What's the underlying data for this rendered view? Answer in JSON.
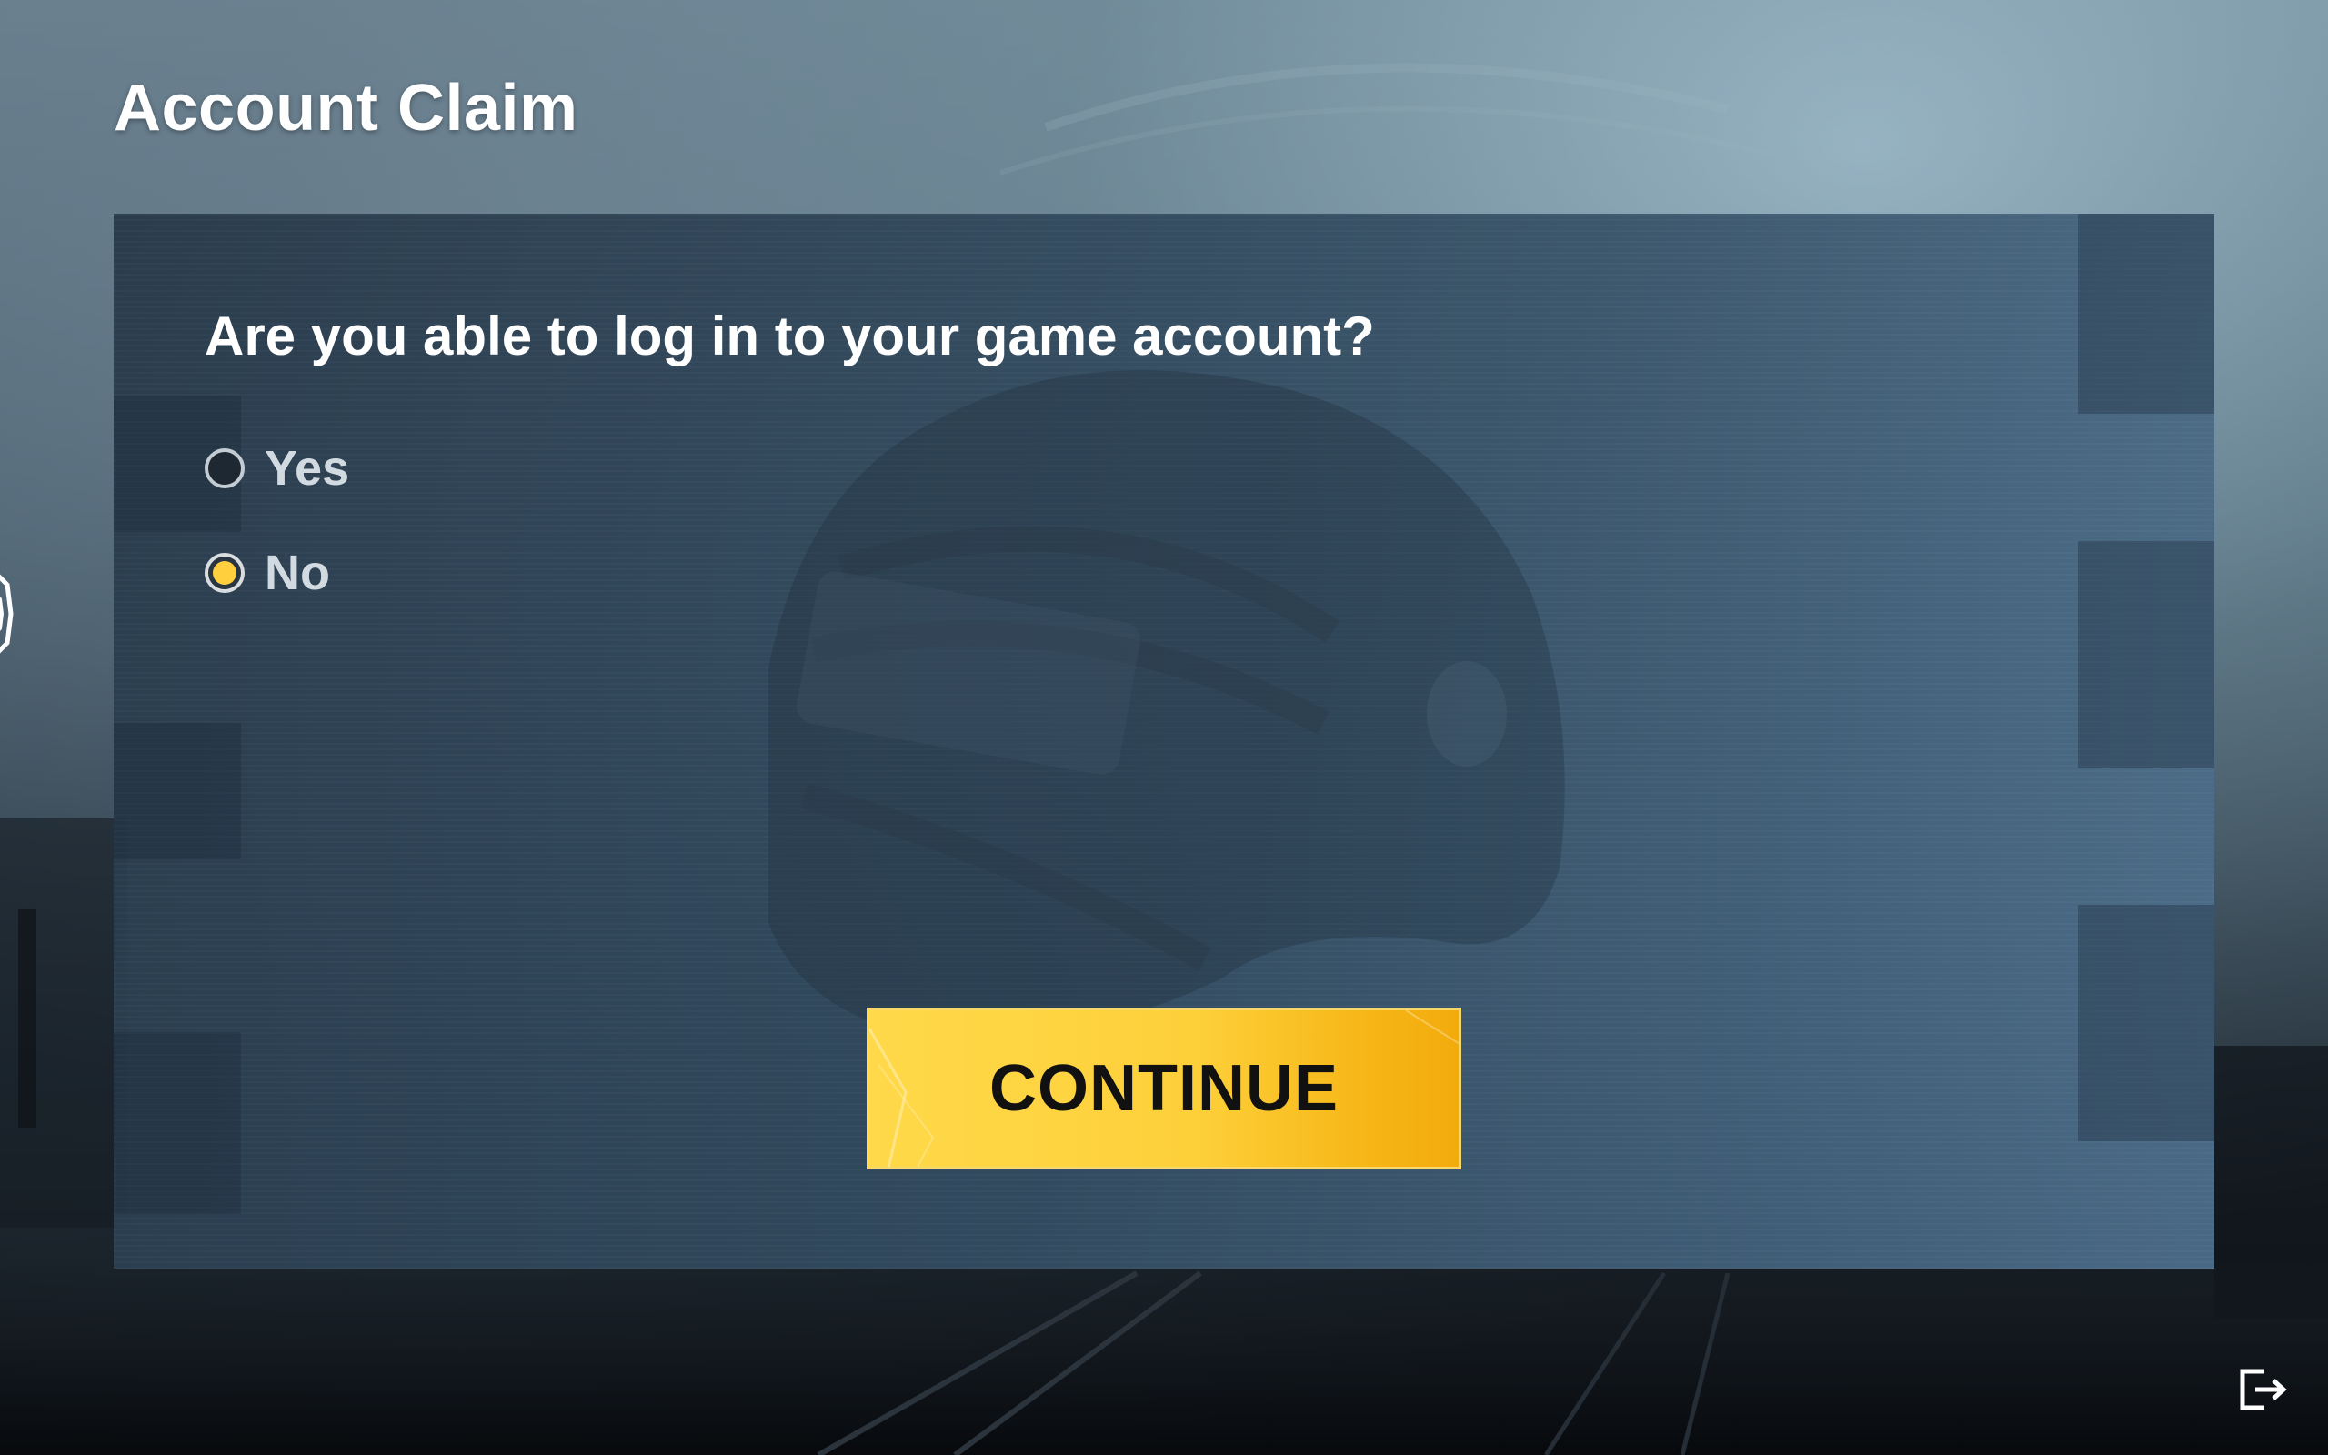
{
  "header": {
    "title": "Account Claim"
  },
  "form": {
    "question": "Are you able to log in to your game account?",
    "options": [
      {
        "label": "Yes",
        "selected": false
      },
      {
        "label": "No",
        "selected": true
      }
    ],
    "continue_label": "CONTINUE"
  },
  "icons": {
    "exit": "exit-icon",
    "side": "hexagon-icon",
    "background_art": "helmet-watermark"
  },
  "colors": {
    "accent": "#ffcf3d",
    "button": "#fdd03a",
    "panel": "#2f4558"
  }
}
